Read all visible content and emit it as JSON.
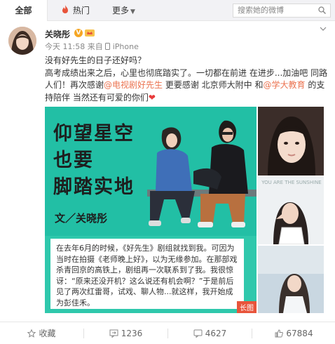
{
  "tabs": {
    "all": "全部",
    "hot": "热门",
    "more": "更多"
  },
  "search": {
    "placeholder": "搜索她的微博"
  },
  "post": {
    "author": "关晓彤",
    "verified_badge": "V",
    "time": "今天 11:58",
    "source_prefix": "来自",
    "source": "iPhone",
    "line1": "没有好先生的日子还好吗？",
    "line2_a": "高考成绩出来之后，心里也彻底踏实了。一切都在前进 在进步...加油吧 同路人们！再次感谢",
    "mention1": "@电视剧好先生",
    "line2_b": " 更要感谢 北京师大附中 和",
    "mention2": "@学大教育",
    "line2_c": " 的支持陪伴 当然还有可爱的你们",
    "heart": "❤"
  },
  "long_image": {
    "headline1": "仰望星空",
    "headline2": "也要",
    "headline3": "脚踏实地",
    "byline": "文／关晓彤",
    "article": "在去年6月的时候，《好先生》剧组就找到我。可因为当时在拍摄《老师晚上好》，以为无缘参加。在那部戏杀青回京的高铁上，剧组再一次联系到了我。我很惊讶：“原来还没开机？这么说还有机会啊？”于是前后见了两次红雷哥，试戏、聊人物...就这样，我开始成为彭佳禾。",
    "badge": "长图"
  },
  "side_photo_text": "YOU ARE THE SUNSHINE",
  "actions": {
    "favorite": "收藏",
    "repost": "1236",
    "comment": "4627",
    "like": "67884"
  },
  "colors": {
    "link": "#eb7350",
    "teal": "#2fc8ac",
    "badge": "#f5a623"
  }
}
